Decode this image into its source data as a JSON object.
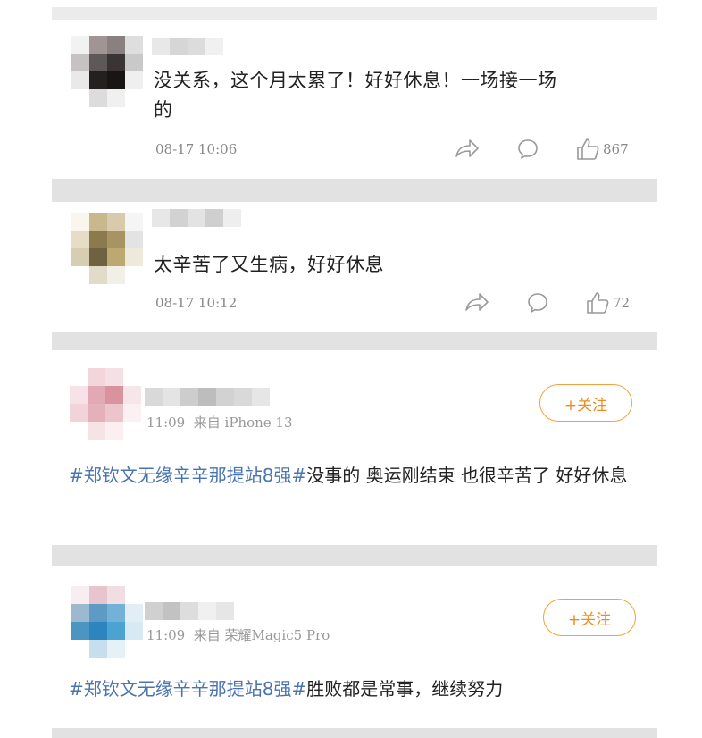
{
  "comments": [
    {
      "text": "没关系，这个月太累了！好好休息！一场接一场的",
      "text_line1": "没关系，这个月太累了！好好休息！一场接一场",
      "text_line2": "的",
      "time": "08-17 10:06",
      "likes": "867"
    },
    {
      "text": "太辛苦了又生病，好好休息",
      "time": "08-17 10:12",
      "likes": "72"
    }
  ],
  "posts": [
    {
      "meta": "11:09  来自 iPhone 13",
      "follow_label": "+关注",
      "topic": "#郑钦文无缘辛辛那提站8强#",
      "body": "没事的 奥运刚结束 也很辛苦了 好好休息"
    },
    {
      "meta": "11:09  来自 荣耀Magic5 Pro",
      "follow_label": "+关注",
      "topic": "#郑钦文无缘辛辛那提站8强#",
      "body": "胜败都是常事，继续努力"
    }
  ],
  "icons": {
    "share": "share-icon",
    "comment": "comment-icon",
    "like": "thumbs-up-icon"
  },
  "colors": {
    "topic": "#4a74b0",
    "follow": "#f08c1c"
  }
}
